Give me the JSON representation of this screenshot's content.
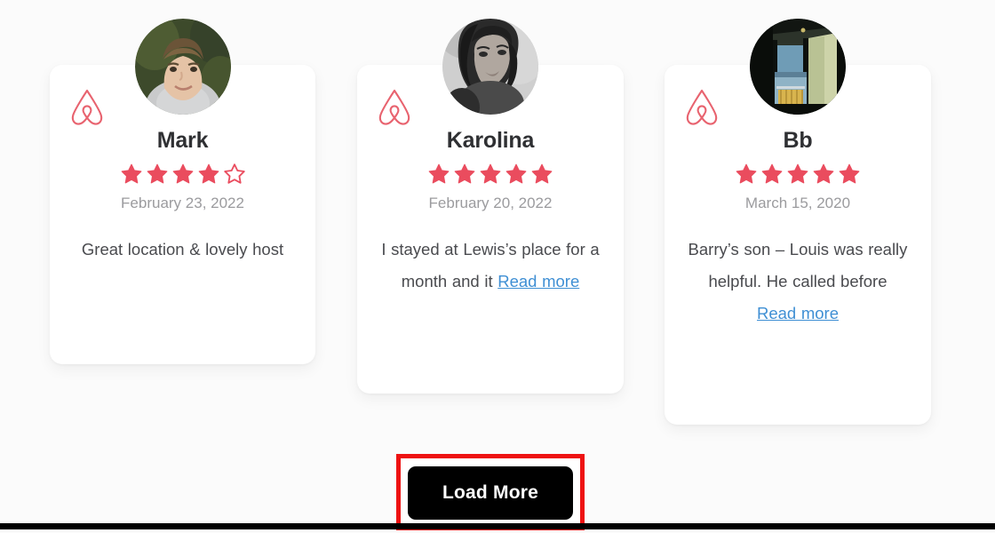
{
  "page": {
    "background_color": "#fbfbfb",
    "accent_color": "#ea4c5e",
    "link_color": "#3f8fd4",
    "highlight_color": "#ee1212"
  },
  "reviews": [
    {
      "logo_icon": "airbnb-belo-icon",
      "avatar_icon": "avatar-photo-mark",
      "name": "Mark",
      "rating": 4,
      "max_rating": 5,
      "date": "February 23, 2022",
      "text": "Great location & lovely host",
      "read_more_label": "",
      "has_read_more": false
    },
    {
      "logo_icon": "airbnb-belo-icon",
      "avatar_icon": "avatar-photo-karolina",
      "name": "Karolina",
      "rating": 5,
      "max_rating": 5,
      "date": "February 20, 2022",
      "text": "I stayed at Lewis’s place for a month and it ",
      "read_more_label": "Read more",
      "has_read_more": true
    },
    {
      "logo_icon": "airbnb-belo-icon",
      "avatar_icon": "avatar-photo-bb",
      "name": "Bb",
      "rating": 5,
      "max_rating": 5,
      "date": "March 15, 2020",
      "text": "Barry’s son – Louis was really helpful. He called before ",
      "read_more_label": "Read more",
      "has_read_more": true
    }
  ],
  "load_more": {
    "label": "Load More"
  }
}
